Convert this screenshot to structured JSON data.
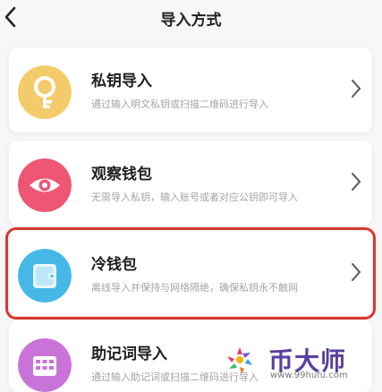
{
  "header": {
    "title": "导入方式",
    "back_icon": "chevron-left-icon"
  },
  "options": [
    {
      "label": "私钥导入",
      "desc": "通过输入明文私钥或扫描二维码进行导入",
      "icon": "key-icon",
      "icon_color": "#f2c85f"
    },
    {
      "label": "观察钱包",
      "desc": "无需导入私钥，输入账号或者对应公钥即可导入",
      "icon": "eye-icon",
      "icon_color": "#ef4f6f"
    },
    {
      "label": "冷钱包",
      "desc": "离线导入并保持与网络隔绝，确保私钥永不触网",
      "icon": "cold-wallet-icon",
      "icon_color": "#3cb3e6"
    },
    {
      "label": "助记词导入",
      "desc": "通过输入助记词或扫描二维码进行导入",
      "icon": "mnemonic-grid-icon",
      "icon_color": "#c86fd6"
    }
  ],
  "highlighted_option": "冷钱包",
  "watermark": {
    "text": "币大师",
    "url": "www.99hufu.com"
  }
}
